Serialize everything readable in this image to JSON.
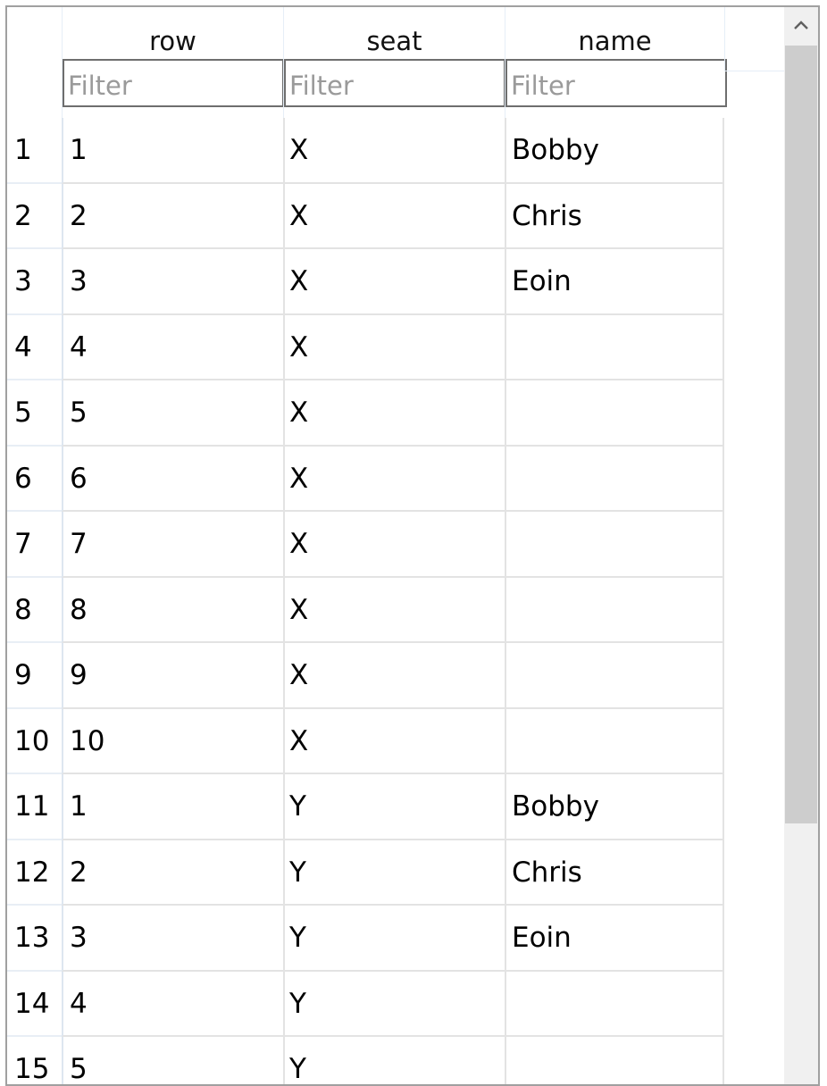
{
  "columns": {
    "row": "row",
    "seat": "seat",
    "name": "name"
  },
  "filters": {
    "row_placeholder": "Filter",
    "seat_placeholder": "Filter",
    "name_placeholder": "Filter"
  },
  "rows": [
    {
      "idx": "1",
      "row": "1",
      "seat": "X",
      "name": "Bobby"
    },
    {
      "idx": "2",
      "row": "2",
      "seat": "X",
      "name": "Chris"
    },
    {
      "idx": "3",
      "row": "3",
      "seat": "X",
      "name": "Eoin"
    },
    {
      "idx": "4",
      "row": "4",
      "seat": "X",
      "name": ""
    },
    {
      "idx": "5",
      "row": "5",
      "seat": "X",
      "name": ""
    },
    {
      "idx": "6",
      "row": "6",
      "seat": "X",
      "name": ""
    },
    {
      "idx": "7",
      "row": "7",
      "seat": "X",
      "name": ""
    },
    {
      "idx": "8",
      "row": "8",
      "seat": "X",
      "name": ""
    },
    {
      "idx": "9",
      "row": "9",
      "seat": "X",
      "name": ""
    },
    {
      "idx": "10",
      "row": "10",
      "seat": "X",
      "name": ""
    },
    {
      "idx": "11",
      "row": "1",
      "seat": "Y",
      "name": "Bobby"
    },
    {
      "idx": "12",
      "row": "2",
      "seat": "Y",
      "name": "Chris"
    },
    {
      "idx": "13",
      "row": "3",
      "seat": "Y",
      "name": "Eoin"
    },
    {
      "idx": "14",
      "row": "4",
      "seat": "Y",
      "name": ""
    },
    {
      "idx": "15",
      "row": "5",
      "seat": "Y",
      "name": ""
    }
  ],
  "scrollbar": {
    "up_icon": "chevron-up-icon",
    "thumb_color": "#cdcdcd",
    "track_color": "#f0f0f0"
  }
}
